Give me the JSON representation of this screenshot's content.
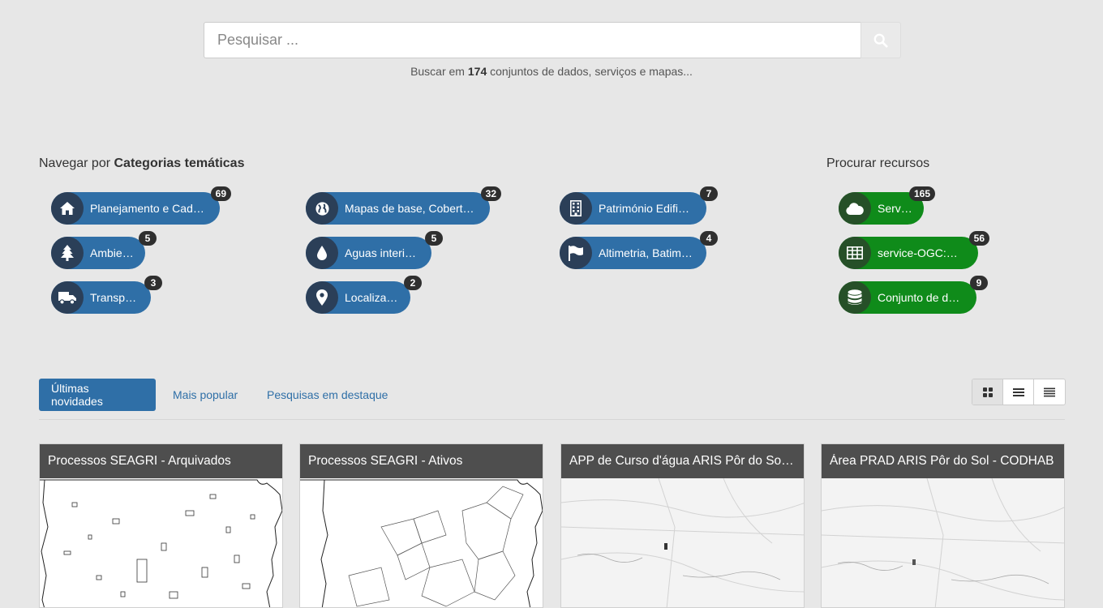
{
  "search": {
    "placeholder": "Pesquisar ...",
    "hint_prefix": "Buscar em ",
    "hint_count": "174",
    "hint_suffix": " conjuntos de dados, serviços e mapas..."
  },
  "categories": {
    "title_prefix": "Navegar por ",
    "title_bold": "Categorias temáticas",
    "items": [
      {
        "label": "Planejamento e Cadastro",
        "count": "69",
        "icon": "home-icon"
      },
      {
        "label": "Mapas de base, Cobertur...",
        "count": "32",
        "icon": "globe-icon"
      },
      {
        "label": "Património Edificado",
        "count": "7",
        "icon": "building-icon"
      },
      {
        "label": "Ambiente",
        "count": "5",
        "icon": "tree-icon"
      },
      {
        "label": "Aguas interiores",
        "count": "5",
        "icon": "drop-icon"
      },
      {
        "label": "Altimetria, Batimetria",
        "count": "4",
        "icon": "flag-icon"
      },
      {
        "label": "Transporte",
        "count": "3",
        "icon": "truck-icon"
      },
      {
        "label": "Localização",
        "count": "2",
        "icon": "map-marker-icon"
      }
    ]
  },
  "resources": {
    "title": "Procurar recursos",
    "items": [
      {
        "label": "Serviço",
        "count": "165",
        "icon": "cloud-icon"
      },
      {
        "label": "service-OGC:WMS",
        "count": "56",
        "icon": "table-icon"
      },
      {
        "label": "Conjunto de dados",
        "count": "9",
        "icon": "database-icon"
      }
    ]
  },
  "tabs": [
    {
      "label": "Últimas novidades",
      "active": true
    },
    {
      "label": "Mais popular",
      "active": false
    },
    {
      "label": "Pesquisas em destaque",
      "active": false
    }
  ],
  "view_modes": [
    "grid-icon",
    "list-icon",
    "compact-list-icon"
  ],
  "cards": [
    {
      "title": "Processos SEAGRI - Arquivados"
    },
    {
      "title": "Processos SEAGRI - Ativos"
    },
    {
      "title": "APP de Curso d'água ARIS Pôr do Sol -..."
    },
    {
      "title": "Área PRAD ARIS Pôr do Sol - CODHAB"
    }
  ],
  "colors": {
    "category_pill": "#2f6fa7",
    "resource_pill": "#0f8b1a",
    "card_header": "#4e4e4e",
    "badge": "#2f2f2f"
  }
}
